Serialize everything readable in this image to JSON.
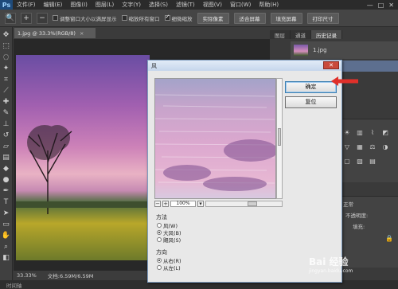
{
  "menubar": {
    "logo": "Ps",
    "items": [
      "文件(F)",
      "编辑(E)",
      "图像(I)",
      "图层(L)",
      "文字(Y)",
      "选择(S)",
      "滤镜(T)",
      "视图(V)",
      "窗口(W)",
      "帮助(H)"
    ],
    "window_controls": [
      "—",
      "□",
      "✕"
    ]
  },
  "options": {
    "checks": [
      {
        "label": "调整窗口大小以满屏显示",
        "checked": false
      },
      {
        "label": "缩放所有窗口",
        "checked": false
      },
      {
        "label": "细微缩放",
        "checked": true
      }
    ],
    "buttons": [
      "实际像素",
      "适合屏幕",
      "填充屏幕",
      "打印尺寸"
    ]
  },
  "document": {
    "tab_title": "1.jpg @ 33.3%(RGB/8)",
    "zoom": "33.33%",
    "doc_info": "文档:6.59M/6.59M",
    "bottom_label": "时间轴"
  },
  "panels": {
    "tabs": [
      "图层",
      "通道",
      "历史记录"
    ],
    "snapshot_name": "1.jpg",
    "history_item": "打开",
    "mode": "正常",
    "opacity_label": "不透明度:",
    "fill_label": "填充:"
  },
  "dialog": {
    "title": "风",
    "close": "✕",
    "ok": "确定",
    "reset": "复位",
    "zoom_value": "100%",
    "method": {
      "title": "方法",
      "options": [
        "风(W)",
        "大风(B)",
        "飓风(S)"
      ],
      "selected": 1
    },
    "direction": {
      "title": "方向",
      "options": [
        "从右(R)",
        "从左(L)"
      ],
      "selected": 0
    }
  },
  "annotation": {
    "arrow_color": "#e0302a"
  },
  "watermark": {
    "text": "Bai 经验",
    "subtext": "jingyan.baidu.com"
  }
}
